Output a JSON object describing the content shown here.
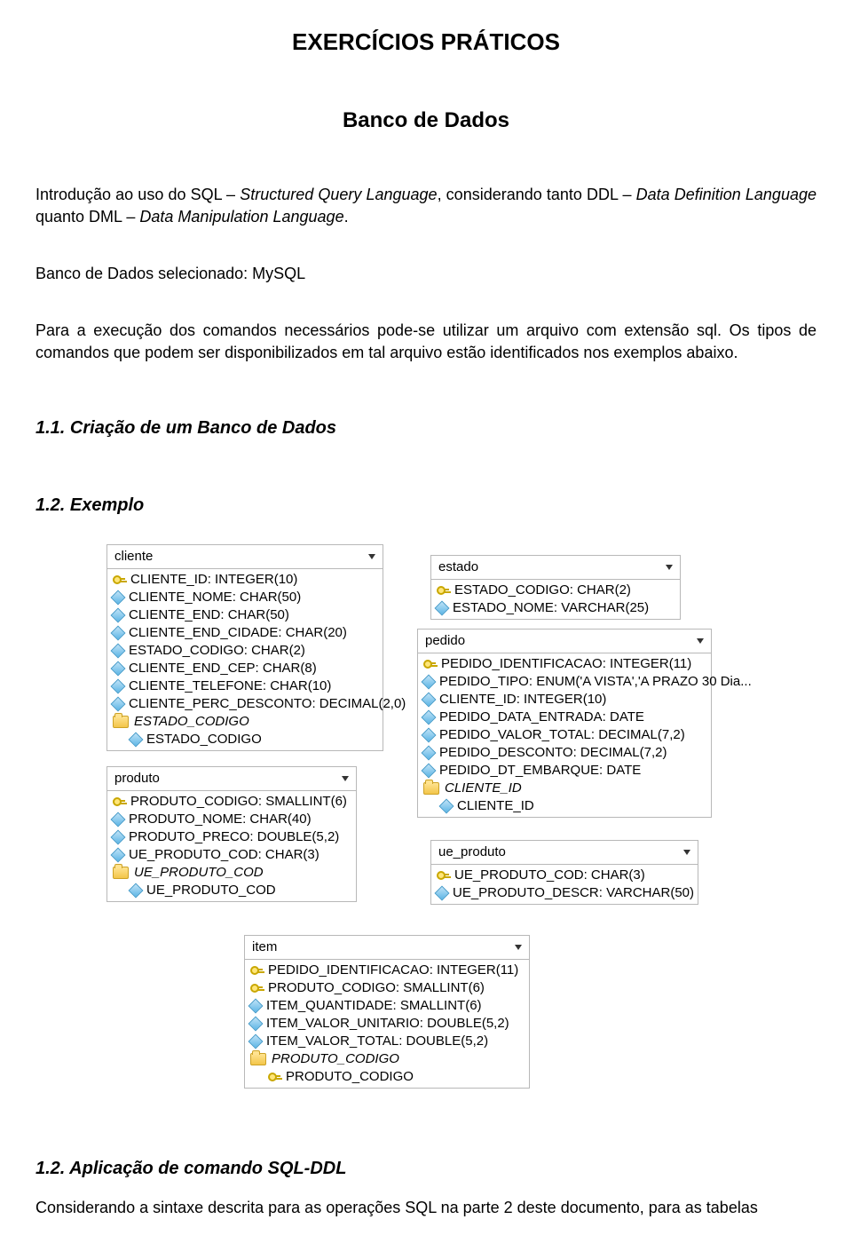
{
  "title": "EXERCÍCIOS PRÁTICOS",
  "subtitle": "Banco de Dados",
  "intro_p1a": "Introdução ao uso do SQL – ",
  "intro_p1b": "Structured Query Language",
  "intro_p1c": ", considerando tanto DDL – ",
  "intro_p1d": "Data Definition Language",
  "intro_p1e": " quanto DML – ",
  "intro_p1f": "Data Manipulation Language",
  "intro_p1g": ".",
  "intro_p2": "Banco de Dados selecionado: MySQL",
  "intro_p3": "Para a execução dos comandos necessários pode-se utilizar um arquivo com extensão sql.  Os tipos de comandos que podem ser disponibilizados em tal arquivo estão identificados nos exemplos abaixo.",
  "section_1_1": "1.1. Criação de um Banco de Dados",
  "section_1_2_ex": "1.2. Exemplo",
  "section_1_2_ap": "1.2.     Aplicação de comando SQL-DDL",
  "final_p": "Considerando a sintaxe descrita para as operações SQL na parte 2 deste documento, para as tabelas",
  "tables": {
    "cliente": {
      "name": "cliente",
      "fields": [
        {
          "icon": "key",
          "label": "CLIENTE_ID: INTEGER(10)"
        },
        {
          "icon": "diamond",
          "label": "CLIENTE_NOME: CHAR(50)"
        },
        {
          "icon": "diamond",
          "label": "CLIENTE_END: CHAR(50)"
        },
        {
          "icon": "diamond",
          "label": "CLIENTE_END_CIDADE: CHAR(20)"
        },
        {
          "icon": "diamond",
          "label": "ESTADO_CODIGO: CHAR(2)"
        },
        {
          "icon": "diamond",
          "label": "CLIENTE_END_CEP: CHAR(8)"
        },
        {
          "icon": "diamond",
          "label": "CLIENTE_TELEFONE: CHAR(10)"
        },
        {
          "icon": "diamond",
          "label": "CLIENTE_PERC_DESCONTO: DECIMAL(2,0)"
        },
        {
          "icon": "folder",
          "label": "ESTADO_CODIGO",
          "italic": true
        },
        {
          "icon": "diamond",
          "label": "ESTADO_CODIGO",
          "indent": true
        }
      ]
    },
    "produto": {
      "name": "produto",
      "fields": [
        {
          "icon": "key",
          "label": "PRODUTO_CODIGO: SMALLINT(6)"
        },
        {
          "icon": "diamond",
          "label": "PRODUTO_NOME: CHAR(40)"
        },
        {
          "icon": "diamond",
          "label": "PRODUTO_PRECO: DOUBLE(5,2)"
        },
        {
          "icon": "diamond",
          "label": "UE_PRODUTO_COD: CHAR(3)"
        },
        {
          "icon": "folder",
          "label": "UE_PRODUTO_COD",
          "italic": true
        },
        {
          "icon": "diamond",
          "label": "UE_PRODUTO_COD",
          "indent": true
        }
      ]
    },
    "estado": {
      "name": "estado",
      "fields": [
        {
          "icon": "key",
          "label": "ESTADO_CODIGO: CHAR(2)"
        },
        {
          "icon": "diamond",
          "label": "ESTADO_NOME: VARCHAR(25)"
        }
      ]
    },
    "pedido": {
      "name": "pedido",
      "fields": [
        {
          "icon": "key",
          "label": "PEDIDO_IDENTIFICACAO: INTEGER(11)"
        },
        {
          "icon": "diamond",
          "label": "PEDIDO_TIPO: ENUM('A VISTA','A PRAZO 30 Dia..."
        },
        {
          "icon": "diamond",
          "label": "CLIENTE_ID: INTEGER(10)"
        },
        {
          "icon": "diamond",
          "label": "PEDIDO_DATA_ENTRADA: DATE"
        },
        {
          "icon": "diamond",
          "label": "PEDIDO_VALOR_TOTAL: DECIMAL(7,2)"
        },
        {
          "icon": "diamond",
          "label": "PEDIDO_DESCONTO: DECIMAL(7,2)"
        },
        {
          "icon": "diamond",
          "label": "PEDIDO_DT_EMBARQUE: DATE"
        },
        {
          "icon": "folder",
          "label": "CLIENTE_ID",
          "italic": true
        },
        {
          "icon": "diamond",
          "label": "CLIENTE_ID",
          "indent": true
        }
      ]
    },
    "ue_produto": {
      "name": "ue_produto",
      "fields": [
        {
          "icon": "key",
          "label": "UE_PRODUTO_COD: CHAR(3)"
        },
        {
          "icon": "diamond",
          "label": "UE_PRODUTO_DESCR: VARCHAR(50)"
        }
      ]
    },
    "item": {
      "name": "item",
      "fields": [
        {
          "icon": "key",
          "label": "PEDIDO_IDENTIFICACAO: INTEGER(11)"
        },
        {
          "icon": "key",
          "label": "PRODUTO_CODIGO: SMALLINT(6)"
        },
        {
          "icon": "diamond",
          "label": "ITEM_QUANTIDADE: SMALLINT(6)"
        },
        {
          "icon": "diamond",
          "label": "ITEM_VALOR_UNITARIO: DOUBLE(5,2)"
        },
        {
          "icon": "diamond",
          "label": "ITEM_VALOR_TOTAL: DOUBLE(5,2)"
        },
        {
          "icon": "folder",
          "label": "PRODUTO_CODIGO",
          "italic": true
        },
        {
          "icon": "key",
          "label": "PRODUTO_CODIGO",
          "indent": true
        }
      ]
    }
  }
}
